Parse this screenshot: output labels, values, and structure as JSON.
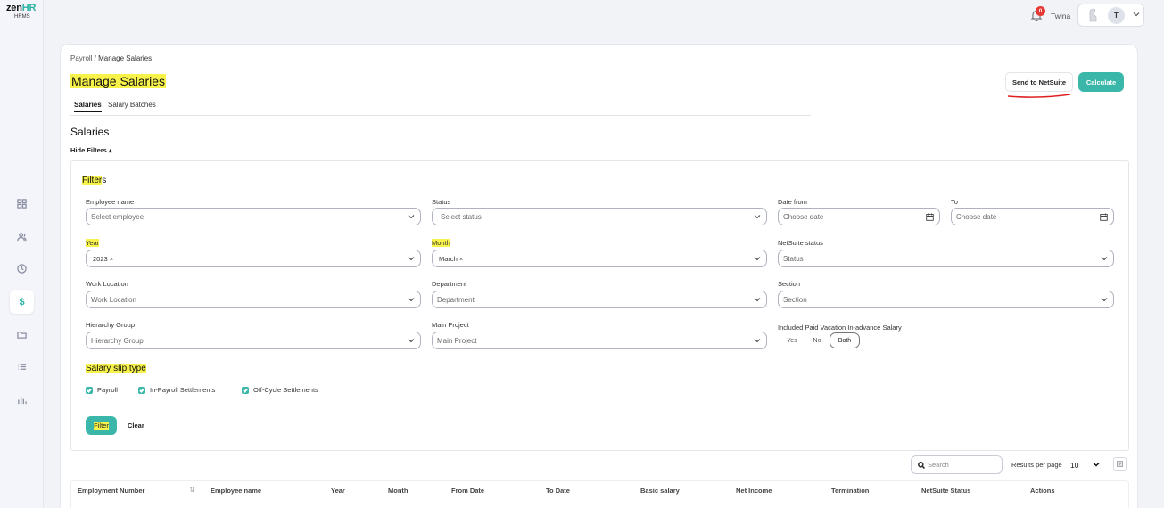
{
  "app": {
    "logo_main": "zen",
    "logo_accent": "HR",
    "logo_sub": "HRMS"
  },
  "topbar": {
    "notifications_count": "0",
    "user_name": "Twina",
    "avatar_initial": "T"
  },
  "breadcrumb": {
    "parent": "Payroll",
    "separator": " / ",
    "current": "Manage Salaries"
  },
  "page": {
    "title": "Manage Salaries",
    "send_button": "Send to NetSuite",
    "calculate_button": "Calculate",
    "tabs": [
      {
        "label": "Salaries",
        "active": true
      },
      {
        "label": "Salary Batches",
        "active": false
      }
    ],
    "section_title": "Salaries",
    "hide_filters": "Hide Filters ▴"
  },
  "filters": {
    "title_hl": "Filter",
    "title_rest": "s",
    "employee_name": {
      "label": "Employee name",
      "placeholder": "Select employee"
    },
    "status": {
      "label": "Status",
      "placeholder": "Select status"
    },
    "date_from": {
      "label": "Date from",
      "placeholder": "Choose date"
    },
    "date_to": {
      "label": "To",
      "placeholder": "Choose date"
    },
    "year": {
      "label": "Year",
      "chip": "2023"
    },
    "month": {
      "label": "Month",
      "chip": "March"
    },
    "netsuite_status": {
      "label": "NetSuite status",
      "placeholder": "Status"
    },
    "work_location": {
      "label": "Work Location",
      "placeholder": "Work Location"
    },
    "department": {
      "label": "Department",
      "placeholder": "Department"
    },
    "section": {
      "label": "Section",
      "placeholder": "Section"
    },
    "hierarchy_group": {
      "label": "Hierarchy Group",
      "placeholder": "Hierarchy Group"
    },
    "main_project": {
      "label": "Main Project",
      "placeholder": "Main Project"
    },
    "paid_vacation": {
      "label": "Included Paid Vacation In-advance Salary",
      "options": [
        "Yes",
        "No",
        "Both"
      ],
      "selected": "Both"
    },
    "slip_type_title": "Salary slip type",
    "slip_types": [
      {
        "label": "Payroll",
        "checked": true
      },
      {
        "label": "In-Payroll Settlements",
        "checked": true
      },
      {
        "label": "Off-Cycle Settlements",
        "checked": true
      }
    ],
    "filter_button": "Filter",
    "clear_button": "Clear"
  },
  "table_controls": {
    "search_placeholder": "Search",
    "results_per_page_label": "Results per page",
    "results_per_page": "10"
  },
  "table": {
    "columns": [
      "Employment Number",
      "Employee name",
      "Year",
      "Month",
      "From Date",
      "To Date",
      "Basic salary",
      "Net Income",
      "Termination",
      "NetSuite Status",
      "Actions"
    ]
  },
  "colors": {
    "accent": "#3ab7a9",
    "highlight": "#f7f34a",
    "badge": "#e53935",
    "annotation": "#e02020"
  }
}
